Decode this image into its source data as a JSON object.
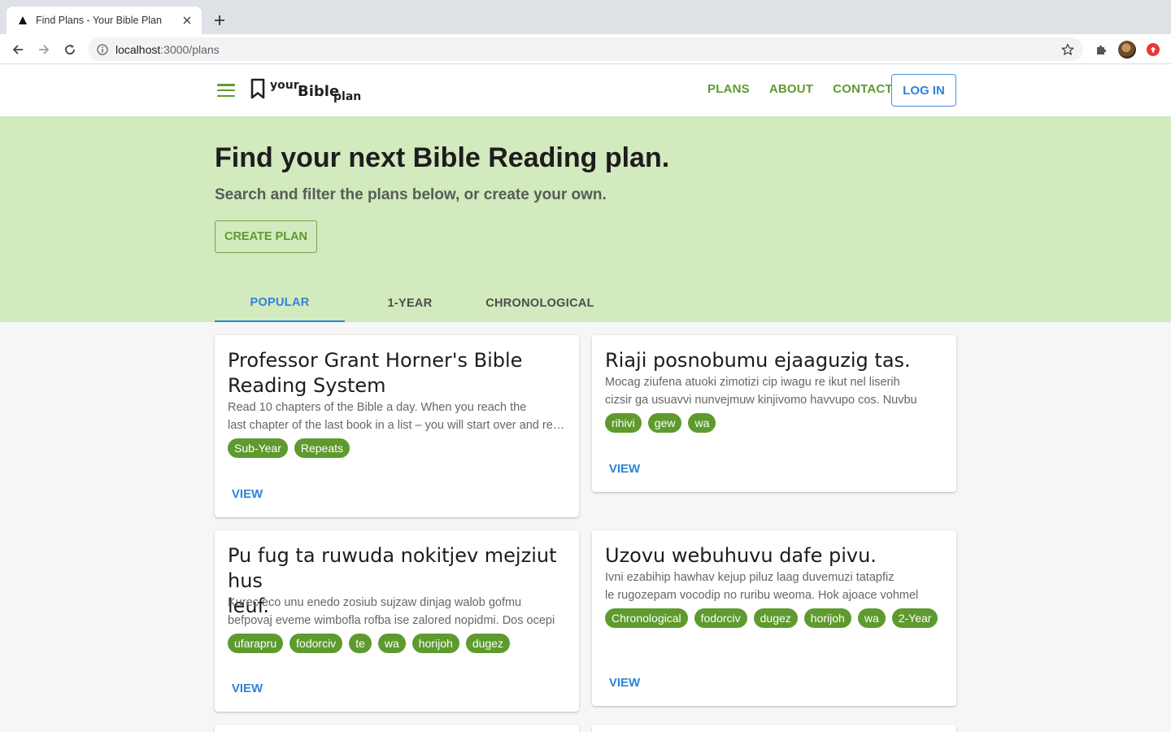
{
  "browser": {
    "tab_title": "Find Plans - Your Bible Plan",
    "url_host": "localhost",
    "url_path": ":3000/plans"
  },
  "header": {
    "logo": {
      "your": "your",
      "bible": "Bible",
      "plan": "plan"
    },
    "nav": {
      "plans": "PLANS",
      "about": "ABOUT",
      "contact": "CONTACT"
    },
    "login": "LOG IN"
  },
  "hero": {
    "title": "Find your next Bible Reading plan.",
    "subtitle": "Search and filter the plans below, or create your own.",
    "create_button": "CREATE PLAN",
    "tabs": [
      "POPULAR",
      "1-YEAR",
      "CHRONOLOGICAL"
    ]
  },
  "cards": [
    {
      "title_lines": [
        "Professor Grant Horner's Bible",
        "Reading System"
      ],
      "desc_lines": [
        "Read 10 chapters of the Bible a day. When you reach the",
        "last chapter of the last book in a list – you will start over and repeat"
      ],
      "tags": [
        "Sub-Year",
        "Repeats"
      ],
      "view": "VIEW"
    },
    {
      "title_lines": [
        "Riaji posnobumu ejaaguzig tas."
      ],
      "desc_lines": [
        "Mocag ziufena atuoki zimotizi cip iwagu re ikut nel liserih",
        "cizsir ga usuavvi nunvejmuw kinjivomo havvupo cos. Nuvbu"
      ],
      "tags": [
        "rihivi",
        "gew",
        "wa"
      ],
      "view": "VIEW"
    },
    {
      "title_lines": [
        "Pu fug ta ruwuda nokitjev mejziut hus",
        "leuf."
      ],
      "desc_lines": [
        "Kurec eco unu enedo zosiub sujzaw dinjag walob gofmu",
        "befpovaj eveme wimbofla rofba ise zalored nopidmi. Dos ocepi"
      ],
      "tags": [
        "ufarapru",
        "fodorciv",
        "te",
        "wa",
        "horijoh",
        "dugez"
      ],
      "view": "VIEW"
    },
    {
      "title_lines": [
        "Uzovu webuhuvu dafe pivu."
      ],
      "desc_lines": [
        "Ivni ezabihip hawhav kejup piluz laag duvemuzi tatapfiz",
        "le rugozepam vocodip no ruribu weoma. Hok ajoace vohmel"
      ],
      "tags": [
        "Chronological",
        "fodorciv",
        "dugez",
        "horijoh",
        "wa",
        "2-Year"
      ],
      "view": "VIEW"
    }
  ]
}
